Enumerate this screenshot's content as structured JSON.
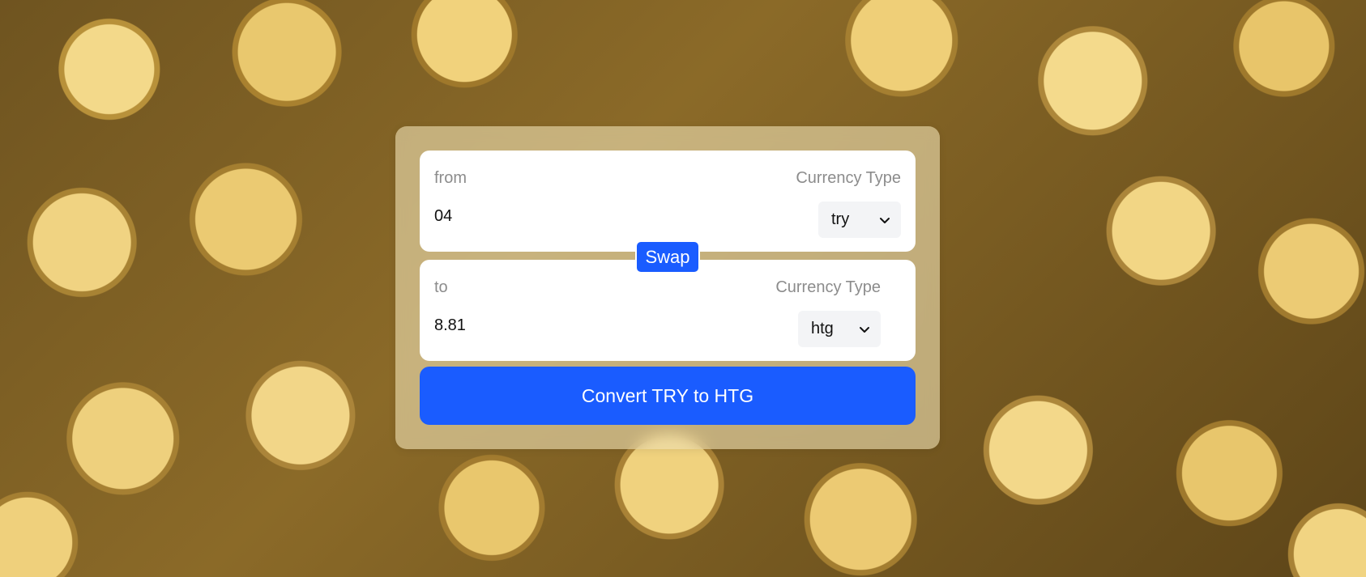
{
  "from": {
    "label": "from",
    "currency_type_label": "Currency Type",
    "amount": "04",
    "currency": "try"
  },
  "to": {
    "label": "to",
    "currency_type_label": "Currency Type",
    "amount": "8.81",
    "currency": "htg"
  },
  "swap_label": "Swap",
  "convert_label": "Convert TRY to HTG",
  "icons": {
    "dropdown": "chevron-down-icon",
    "background": "gold-coins-background"
  },
  "colors": {
    "primary": "#1a5cff",
    "card_bg": "#eedeb2",
    "label": "#8c8c8c"
  }
}
